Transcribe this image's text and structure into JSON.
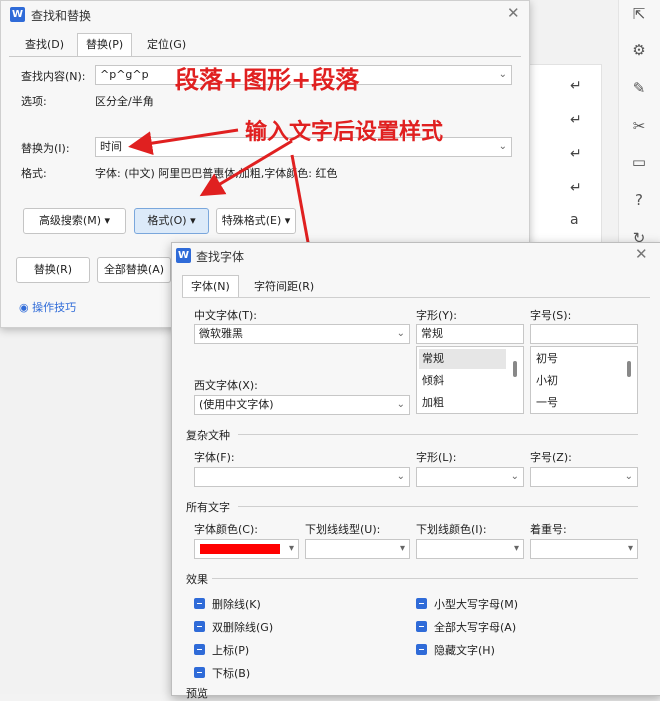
{
  "find_replace": {
    "title": "查找和替换",
    "tabs": [
      "查找(D)",
      "替换(P)",
      "定位(G)"
    ],
    "find_label": "查找内容(N):",
    "find_value": "^p^g^p",
    "options_label": "选项:",
    "options_value": "区分全/半角",
    "replace_label": "替换为(I):",
    "replace_value": "时间",
    "format_label": "格式:",
    "format_value": "字体: (中文) 阿里巴巴普惠体,加粗,字体颜色: 红色",
    "adv_search": "高级搜索(M)",
    "format_btn": "格式(O)",
    "special_btn": "特殊格式(E)",
    "replace_btn": "替换(R)",
    "replace_all_btn": "全部替换(A)",
    "tips": "操作技巧"
  },
  "annotations": {
    "a1": "段落+图形+段落",
    "a2": "输入文字后设置样式"
  },
  "find_font": {
    "title": "查找字体",
    "tabs": [
      "字体(N)",
      "字符间距(R)"
    ],
    "cn_font_label": "中文字体(T):",
    "cn_font_value": "微软雅黑",
    "style_label": "字形(Y):",
    "style_value": "常规",
    "size_label": "字号(S):",
    "size_value": "",
    "style_list": [
      "常规",
      "倾斜",
      "加粗"
    ],
    "size_list": [
      "初号",
      "小初",
      "一号"
    ],
    "west_font_label": "西文字体(X):",
    "west_font_value": "(使用中文字体)",
    "complex_section": "复杂文种",
    "complex_font_label": "字体(F):",
    "complex_style_label": "字形(L):",
    "complex_size_label": "字号(Z):",
    "all_text_section": "所有文字",
    "font_color_label": "字体颜色(C):",
    "underline_type_label": "下划线线型(U):",
    "underline_color_label": "下划线颜色(I):",
    "emphasis_label": "着重号:",
    "font_color_value": "#ff0000",
    "effects_section": "效果",
    "effects": [
      "删除线(K)",
      "双删除线(G)",
      "上标(P)",
      "下标(B)",
      "小型大写字母(M)",
      "全部大写字母(A)",
      "隐藏文字(H)"
    ],
    "preview_section": "预览"
  },
  "background": {
    "para_marks": [
      "↵",
      "↵",
      "↵",
      "↵",
      "a"
    ]
  }
}
